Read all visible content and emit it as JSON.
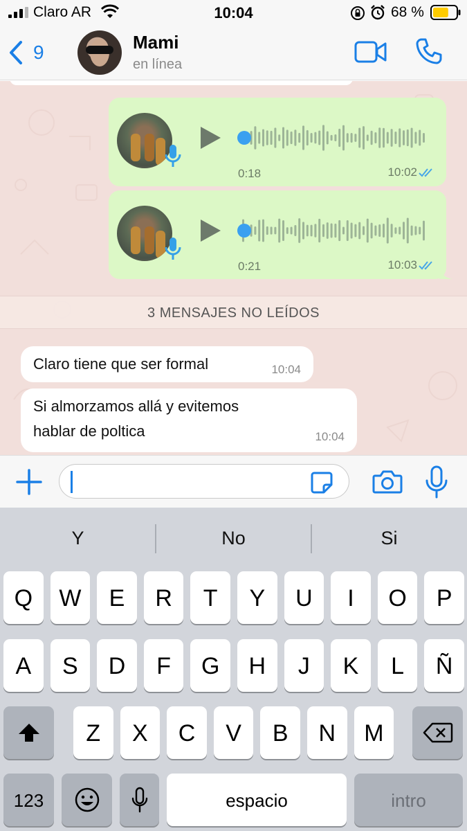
{
  "status_bar": {
    "carrier": "Claro AR",
    "time": "10:04",
    "battery_percent": "68 %",
    "battery_level": 0.68,
    "icons": [
      "signal-icon",
      "wifi-icon",
      "rotation-lock-icon",
      "alarm-icon",
      "battery-icon"
    ]
  },
  "header": {
    "back_count": "9",
    "contact_name": "Mami",
    "contact_status": "en línea",
    "icons": [
      "back-chevron-icon",
      "video-call-icon",
      "phone-call-icon"
    ]
  },
  "messages": {
    "voice_notes": [
      {
        "duration": "0:18",
        "time": "10:02",
        "read": true
      },
      {
        "duration": "0:21",
        "time": "10:03",
        "read": true
      }
    ],
    "unread_banner": "3 MENSAJES NO LEÍDOS",
    "incoming": [
      {
        "text_lines": [
          "Claro tiene que ser formal"
        ],
        "time": "10:04"
      },
      {
        "text_lines": [
          "Si almorzamos allá y evitemos",
          "hablar de poltica"
        ],
        "time": "10:04"
      }
    ]
  },
  "composer": {
    "value": "",
    "icons": [
      "plus-icon",
      "sticker-icon",
      "camera-icon",
      "microphone-icon"
    ]
  },
  "keyboard": {
    "suggestions": [
      "Y",
      "No",
      "Si"
    ],
    "row1": [
      "Q",
      "W",
      "E",
      "R",
      "T",
      "Y",
      "U",
      "I",
      "O",
      "P"
    ],
    "row2": [
      "A",
      "S",
      "D",
      "F",
      "G",
      "H",
      "J",
      "K",
      "L",
      "Ñ"
    ],
    "row3": [
      "Z",
      "X",
      "C",
      "V",
      "B",
      "N",
      "M"
    ],
    "numbers_key": "123",
    "space_key": "espacio",
    "return_key": "intro",
    "icons": [
      "shift-icon",
      "delete-icon",
      "emoji-icon",
      "dictation-icon"
    ]
  },
  "colors": {
    "accent_blue": "#1a7fe6",
    "outgoing_bubble": "#dcf8c6",
    "chat_background": "#f2dfdb",
    "keyboard_background": "#d2d5db"
  }
}
